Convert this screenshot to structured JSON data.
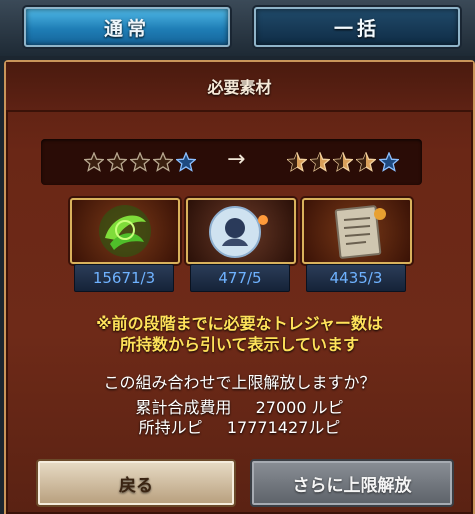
{
  "tabs": {
    "normal_label": "通常",
    "bulk_label": "一括"
  },
  "panel": {
    "title": "必要素材"
  },
  "stars": {
    "before": {
      "filled": 0,
      "blue": 1,
      "total": 5
    },
    "after": {
      "filled": 4,
      "blue": 1,
      "total": 5
    },
    "arrow": "→"
  },
  "materials": [
    {
      "icon": "green-leaf-orb-icon",
      "count": "15671/3"
    },
    {
      "icon": "character-crystal-orb-icon",
      "count": "477/5"
    },
    {
      "icon": "scroll-scripture-icon",
      "count": "4435/3"
    }
  ],
  "note": {
    "line1": "※前の段階までに必要なトレジャー数は",
    "line2": "所持数から引いて表示しています"
  },
  "confirm": {
    "question": "この組み合わせで上限解放しますか？",
    "cost_label": "累計合成費用",
    "cost_value": "27000 ルピ",
    "owned_label": "所持ルピ",
    "owned_value": "17771427ルピ"
  },
  "buttons": {
    "back_label": "戻る",
    "confirm_label": "さらに上限解放"
  },
  "colors": {
    "accent_blue": "#1f7eb6",
    "panel_red": "#6a2716",
    "gold": "#d9b25c",
    "note_yellow": "#ffe25a",
    "count_blue": "#6fb2ff"
  }
}
